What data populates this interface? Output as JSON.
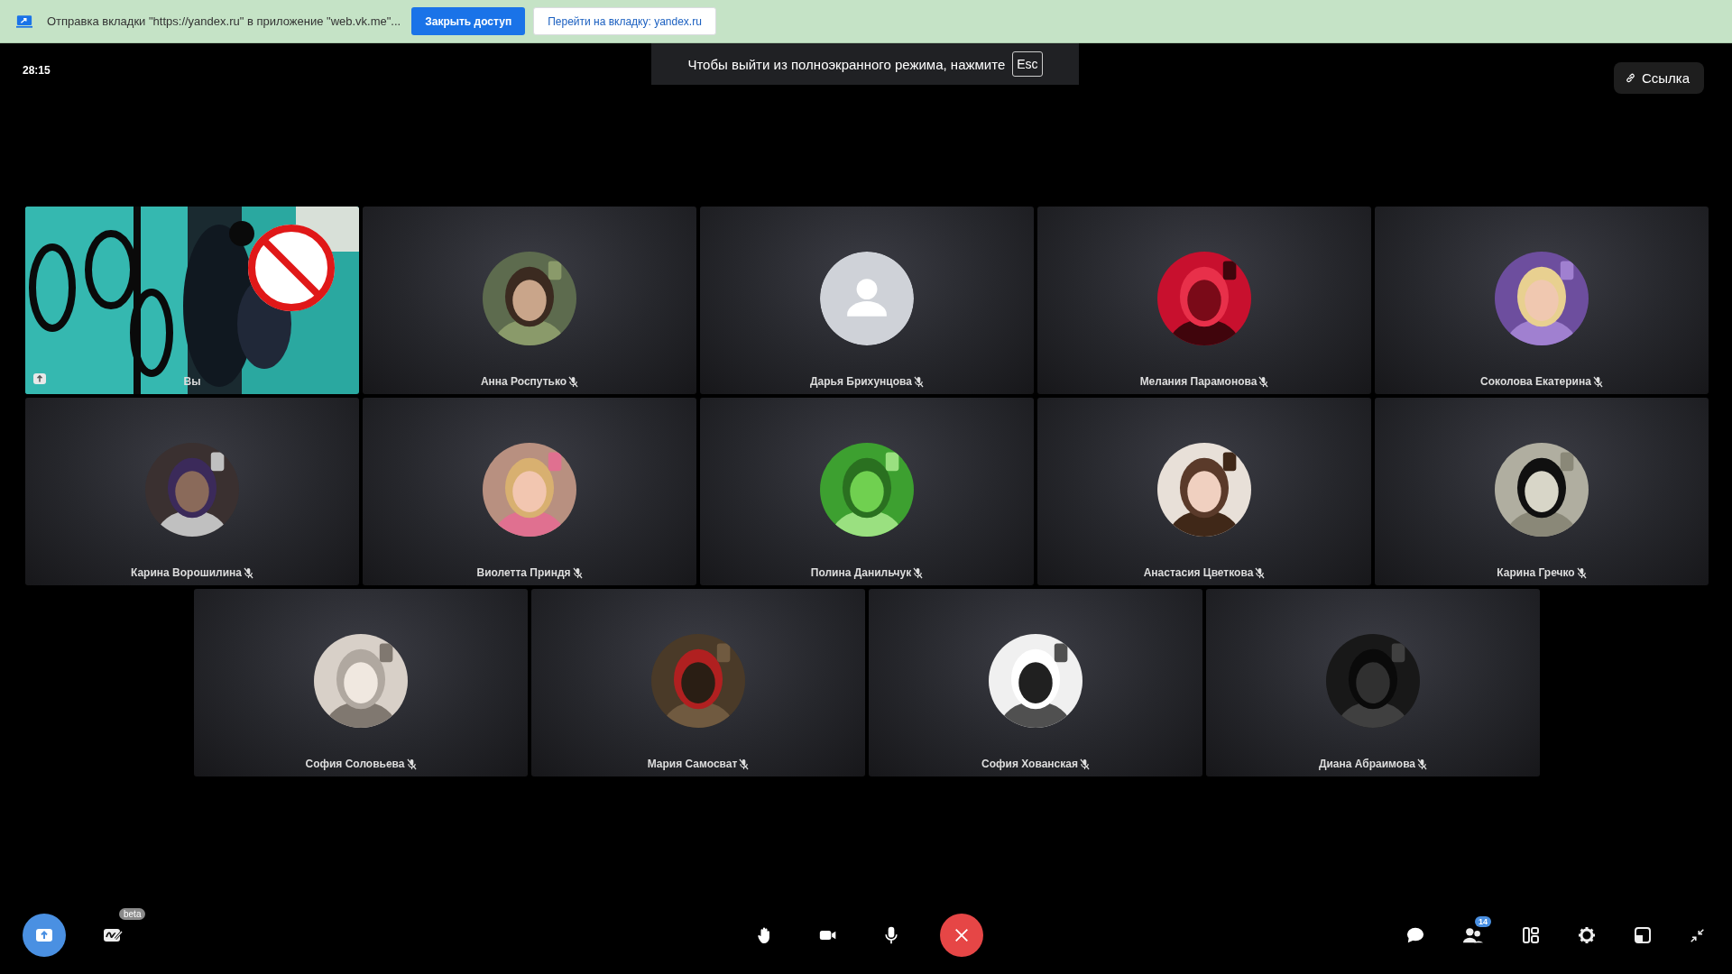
{
  "banner": {
    "text": "Отправка вкладки \"https://yandex.ru\" в приложение \"web.vk.me\"...",
    "buttons": [
      {
        "label": "Закрыть доступ",
        "kind": "primary"
      },
      {
        "label": "Перейти на вкладку: yandex.ru",
        "kind": "secondary"
      }
    ]
  },
  "fullscreen_hint": {
    "text": "Чтобы выйти из полноэкранного режима, нажмите",
    "key": "Esc"
  },
  "timer": "28:15",
  "link_button": {
    "label": "Ссылка"
  },
  "participants": [
    {
      "name": "Вы",
      "kind": "video",
      "muted": false
    },
    {
      "name": "Анна Роспутько",
      "muted": true
    },
    {
      "name": "Дарья Брихунцова",
      "kind": "placeholder",
      "muted": true
    },
    {
      "name": "Мелания Парамонова",
      "muted": true
    },
    {
      "name": "Соколова Екатерина",
      "muted": true
    },
    {
      "name": "Карина Ворошилина",
      "muted": true
    },
    {
      "name": "Виолетта Приндя",
      "muted": true
    },
    {
      "name": "Полина Данильчук",
      "muted": true
    },
    {
      "name": "Анастасия Цветкова",
      "muted": true
    },
    {
      "name": "Карина Гречко",
      "muted": true
    },
    {
      "name": "София Соловьева",
      "muted": true
    },
    {
      "name": "Мария Самосват",
      "muted": true
    },
    {
      "name": "София Хованская",
      "muted": true
    },
    {
      "name": "Диана Абраимова",
      "muted": true
    }
  ],
  "toolbar": {
    "whiteboard_badge": "beta",
    "participants_count": "14"
  }
}
